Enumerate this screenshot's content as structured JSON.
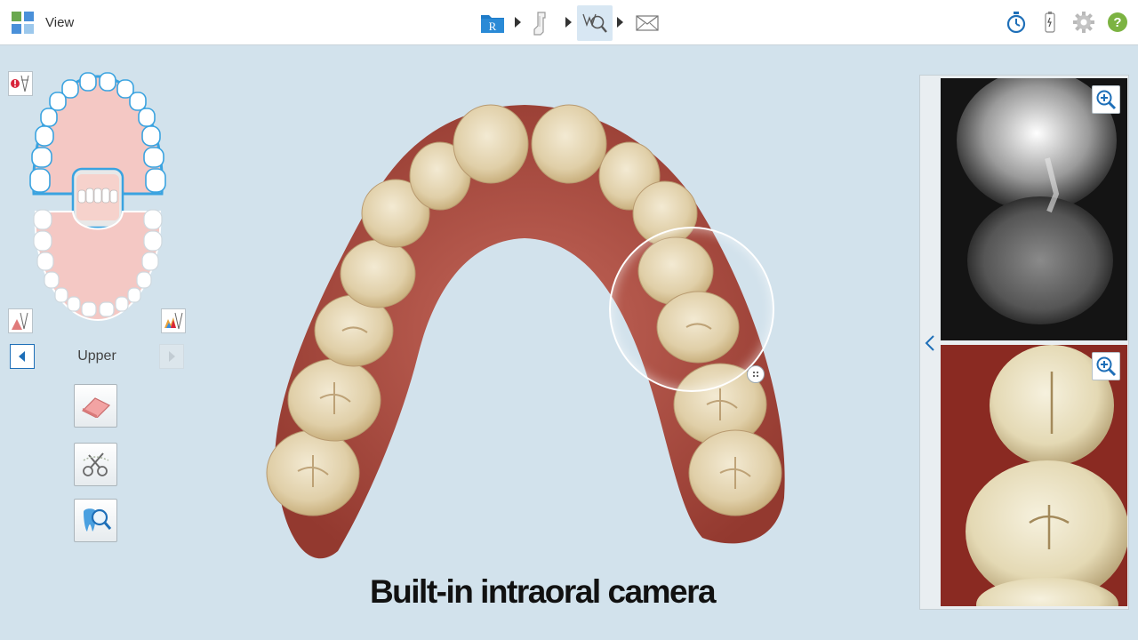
{
  "app": {
    "title": "View"
  },
  "toolbar": {
    "workflow": [
      {
        "name": "rx",
        "icon": "rx-folder-icon",
        "letter": "R"
      },
      {
        "name": "scan",
        "icon": "scan-wand-icon"
      },
      {
        "name": "view",
        "icon": "view-magnify-icon",
        "active": true
      },
      {
        "name": "send",
        "icon": "envelope-icon"
      }
    ],
    "right": [
      {
        "icon": "stopwatch-icon"
      },
      {
        "icon": "wand-battery-icon"
      },
      {
        "icon": "gear-icon"
      },
      {
        "icon": "help-icon",
        "glyph": "?"
      }
    ]
  },
  "left_panel": {
    "jaw": {
      "label": "Upper"
    },
    "tools": [
      {
        "icon": "eraser-icon"
      },
      {
        "icon": "scissors-icon"
      },
      {
        "icon": "tooth-magnify-icon"
      }
    ]
  },
  "caption": {
    "text": "Built-in intraoral camera"
  },
  "colors": {
    "background": "#d2e2ec",
    "accent": "#1e6fb8",
    "gum": "#a84a3e",
    "tooth": "#e8dcc0",
    "tooth_map_outline": "#3aa3e0",
    "help_green": "#7cb342"
  }
}
